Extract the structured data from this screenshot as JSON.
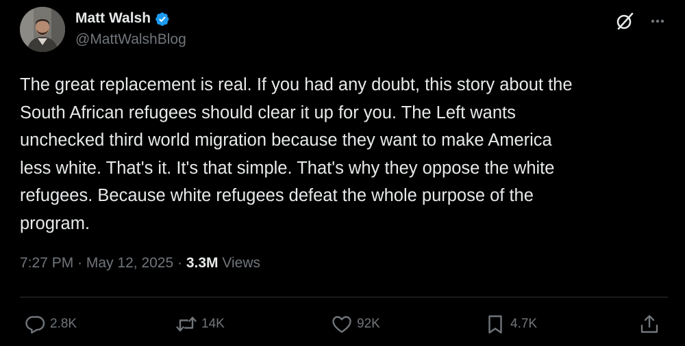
{
  "author": {
    "display_name": "Matt Walsh",
    "handle": "@MattWalshBlog",
    "verified": true
  },
  "tweet": {
    "lines": [
      "The great replacement is real. If you had any doubt, this story about the",
      "South African refugees should clear it up for you. The Left wants",
      "unchecked third world migration because they want to make America",
      "less white. That's it. It's that simple. That's why they oppose the white",
      "refugees. Because white refugees defeat the whole purpose of the",
      "program."
    ]
  },
  "meta": {
    "time": "7:27 PM",
    "separator": "·",
    "date": "May 12, 2025",
    "views_count": "3.3M",
    "views_label": "Views"
  },
  "actions": {
    "replies": "2.8K",
    "reposts": "14K",
    "likes": "92K",
    "bookmarks": "4.7K"
  },
  "icons": {
    "verified": "verified-badge-icon",
    "grok": "grok-icon",
    "more": "more-icon",
    "reply": "reply-icon",
    "repost": "repost-icon",
    "like": "heart-icon",
    "bookmark": "bookmark-icon",
    "share": "share-icon"
  },
  "colors": {
    "background": "#000000",
    "primary_text": "#e7e9ea",
    "secondary_text": "#71767b",
    "verified": "#1d9bf0",
    "divider": "#2f3336"
  }
}
